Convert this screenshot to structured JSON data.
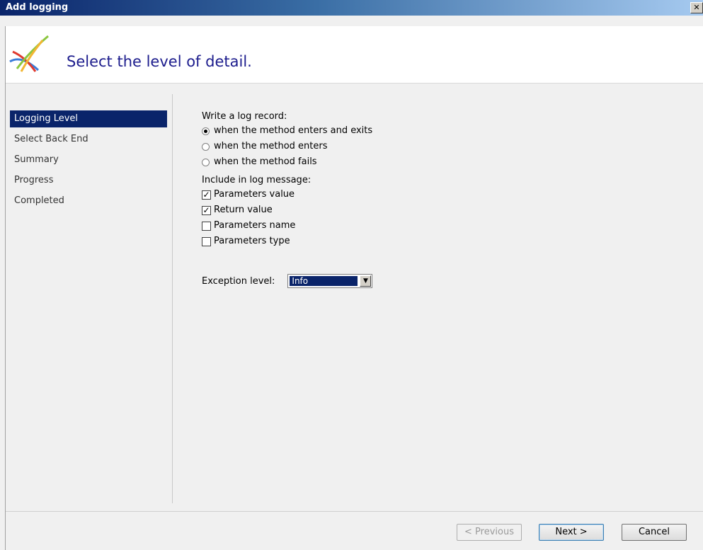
{
  "window": {
    "title": "Add logging",
    "close_glyph": "✕"
  },
  "header": {
    "title": "Select the level of detail.",
    "logo_icon": "wizard-logo-icon"
  },
  "nav": {
    "items": [
      {
        "label": "Logging Level",
        "active": true
      },
      {
        "label": "Select Back End",
        "active": false
      },
      {
        "label": "Summary",
        "active": false
      },
      {
        "label": "Progress",
        "active": false
      },
      {
        "label": "Completed",
        "active": false
      }
    ]
  },
  "log_record": {
    "label": "Write a log record:",
    "options": [
      {
        "label": "when the method enters and exits",
        "selected": true
      },
      {
        "label": "when the method enters",
        "selected": false
      },
      {
        "label": "when the method fails",
        "selected": false
      }
    ]
  },
  "include": {
    "label": "Include in log message:",
    "options": [
      {
        "label": "Parameters value",
        "checked": true
      },
      {
        "label": "Return value",
        "checked": true
      },
      {
        "label": "Parameters name",
        "checked": false
      },
      {
        "label": "Parameters type",
        "checked": false
      }
    ]
  },
  "exception": {
    "label": "Exception level:",
    "value": "Info"
  },
  "buttons": {
    "previous": "< Previous",
    "next": "Next >",
    "cancel": "Cancel"
  },
  "colors": {
    "accent": "#0a246a",
    "header_title": "#1d1d8d"
  }
}
